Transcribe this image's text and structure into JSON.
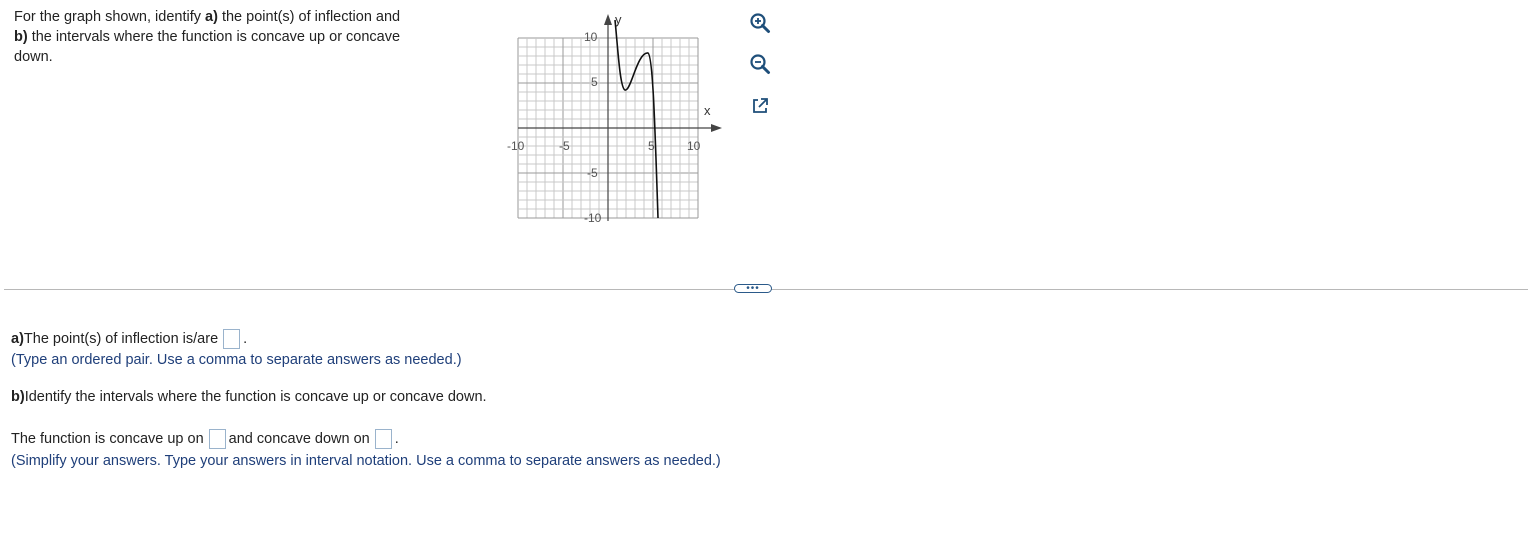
{
  "question": {
    "part1": "For the graph shown, identify ",
    "a_label": "a)",
    "part2": " the point(s) of inflection and",
    "b_label": "b)",
    "part3": " the intervals where the function is concave up or concave",
    "part4": "down."
  },
  "graph": {
    "x_axis_label": "x",
    "y_axis_label": "y",
    "x_ticks": [
      "-10",
      "-5",
      "5",
      "10"
    ],
    "y_ticks": [
      "10",
      "5",
      "-5",
      "-10"
    ],
    "xlim": [
      -10,
      10
    ],
    "ylim": [
      -10,
      10
    ],
    "grid": true,
    "curve_color": "#000000"
  },
  "tools": {
    "zoom_in_icon": "zoom-in-icon",
    "zoom_out_icon": "zoom-out-icon",
    "popout_icon": "external-link-icon"
  },
  "more_button_label": "•••",
  "answers": {
    "a_label": "a)",
    "a_text": " The point(s) of inflection is/are",
    "a_period": ".",
    "a_hint": "(Type an ordered pair. Use a comma to separate answers as needed.)",
    "b_label": "b)",
    "b_text": " Identify the intervals where the function is concave up or concave down.",
    "concave_up_text": "The function is concave up on",
    "concave_down_text": "and concave down on",
    "end_period": ".",
    "b_hint": "(Simplify your answers. Type your answers in interval notation. Use a comma to separate answers as needed.)"
  }
}
